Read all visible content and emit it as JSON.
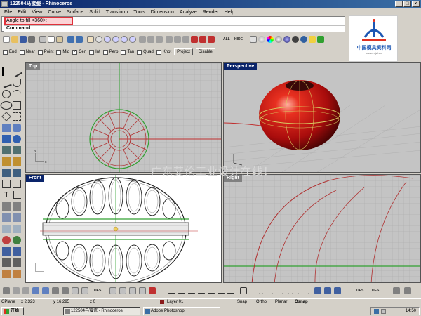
{
  "window": {
    "title": "122504马蜜瓷 - Rhinoceros"
  },
  "menubar": {
    "items": [
      "File",
      "Edit",
      "View",
      "Curve",
      "Surface",
      "Solid",
      "Transform",
      "Tools",
      "Dimension",
      "Analyze",
      "Render",
      "Help"
    ]
  },
  "command": {
    "history_line": "Angle to fill <360>:",
    "prompt_label": "Command:",
    "prompt_value": ""
  },
  "logo": {
    "title": "中国模具资料网",
    "url": "www.mjzl.cn"
  },
  "toolbar": {
    "labels": [
      "ALL",
      "HIDE",
      "DES",
      "DES",
      "DES"
    ]
  },
  "osnap": {
    "items": [
      {
        "label": "End",
        "checked": false
      },
      {
        "label": "Near",
        "checked": false
      },
      {
        "label": "Point",
        "checked": false
      },
      {
        "label": "Mid",
        "checked": false
      },
      {
        "label": "Cen",
        "checked": true
      },
      {
        "label": "Int",
        "checked": false
      },
      {
        "label": "Perp",
        "checked": false
      },
      {
        "label": "Tan",
        "checked": false
      },
      {
        "label": "Quad",
        "checked": false
      },
      {
        "label": "Knot",
        "checked": false
      }
    ],
    "project_label": "Project",
    "disable_label": "Disable"
  },
  "viewports": {
    "top": {
      "label": "Top"
    },
    "perspective": {
      "label": "Perspective"
    },
    "front": {
      "label": "Front"
    },
    "right": {
      "label": "Right"
    }
  },
  "watermark": "广东艾伦工业设计在线！",
  "statusbar": {
    "cplane": "CPlane",
    "x": "x 2.323",
    "y": "y 16.295",
    "z": "z 0",
    "layer": "Layer 01",
    "snap": "Snap",
    "ortho": "Ortho",
    "planar": "Planar",
    "osnap": "Osnap"
  },
  "taskbar": {
    "start_label": "开始",
    "items": [
      "122504马蜜瓷 - Rhinoceros",
      "Adobe Photoshop"
    ],
    "clock": "14:50"
  },
  "colors": {
    "title_gradient_start": "#0a246a",
    "highlight": "#e0303a",
    "model_red": "#c81818",
    "model_lines": "#b03030"
  }
}
